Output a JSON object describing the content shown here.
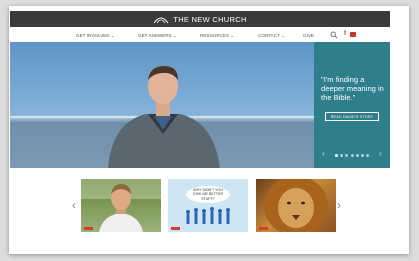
{
  "site": {
    "title": "THE NEW CHURCH"
  },
  "nav": {
    "items": [
      "GET INVOLVED ⌄",
      "GET ANSWERS ⌄",
      "RESOURCES ⌄",
      "CONTACT ⌄",
      "GIVE"
    ],
    "icons": [
      "search-icon",
      "facebook-icon",
      "youtube-icon"
    ]
  },
  "hero": {
    "quote": "\"I'm finding a deeper meaning in the Bible.\"",
    "button_label": "READ DAVID'S STORY",
    "slide_count": 7,
    "active_slide": 1
  },
  "cards": [
    {
      "caption": ""
    },
    {
      "caption": "WHY DIDN'T YOU GIVE ME BETTER STUFF?"
    },
    {
      "caption": ""
    }
  ],
  "colors": {
    "topbar": "#3a3a3a",
    "panel": "#2e7e8c",
    "accent": "#d93a2b"
  }
}
